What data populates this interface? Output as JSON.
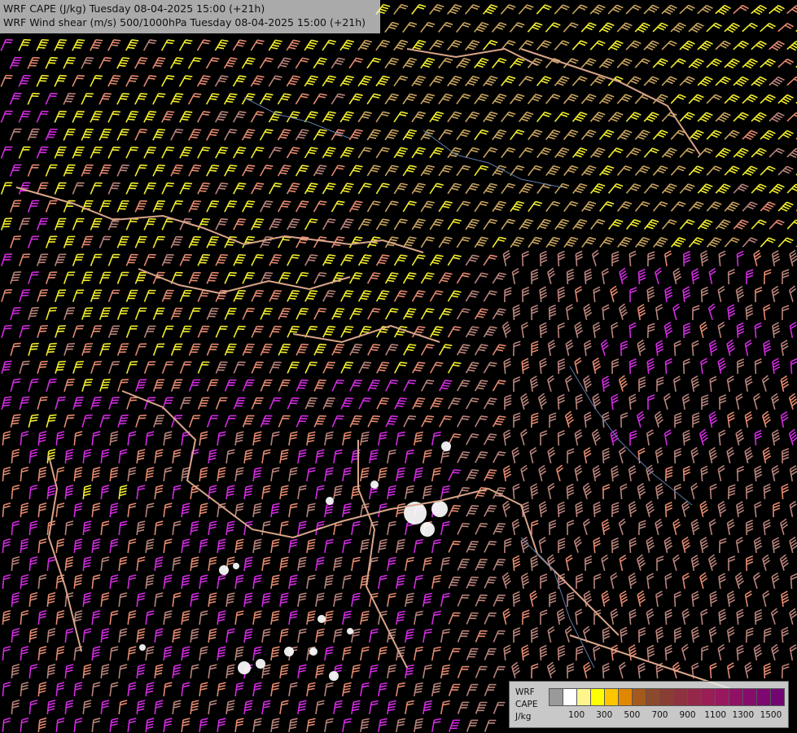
{
  "header": {
    "line1": "WRF CAPE (J/kg) Tuesday 08-04-2025 15:00 (+21h)",
    "line2": "WRF Wind shear (m/s) 500/1000hPa Tuesday 08-04-2025 15:00 (+21h)"
  },
  "legend": {
    "labels": [
      "WRF",
      "CAPE",
      "J/kg"
    ],
    "colors": [
      "#9a9a9a",
      "#ffffff",
      "#fff58c",
      "#ffff00",
      "#ffc600",
      "#e28700",
      "#a5591c",
      "#8b4a2b",
      "#8a3d32",
      "#8e3240",
      "#95284a",
      "#9a1e55",
      "#98175e",
      "#8f1166",
      "#860c6c",
      "#7c0870",
      "#730573"
    ],
    "ticks": [
      "100",
      "300",
      "500",
      "700",
      "900",
      "1100",
      "1300",
      "1500"
    ]
  },
  "map_style": {
    "barb_colors": {
      "yellow": "#f2ee2e",
      "tan": "#c9a55f",
      "salmon": "#e58a70",
      "rose": "#b9847c",
      "magenta": "#d22ce0"
    },
    "border_color": "#d9a58a",
    "river_color": "#5d79a6"
  }
}
